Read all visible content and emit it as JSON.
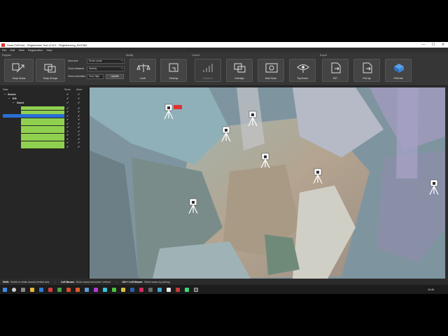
{
  "window": {
    "title": "Scan PinPoint · Registration Tool v2.6.0 · Registrierung_BLK360",
    "minimize": "—",
    "maximize": "☐",
    "close": "✕"
  },
  "menu": [
    "File",
    "Edit",
    "View",
    "Registration",
    "Help"
  ],
  "toolbar": {
    "groups": {
      "register": "Register",
      "modify": "Modify",
      "control": "Control",
      "export": "Export"
    },
    "buttons": {
      "snap_scans": "Snap Scans",
      "snap_groups": "Snap Groups",
      "level": "Level",
      "cleanup": "Cleanup",
      "distance": "Distance",
      "overlaps": "Overlaps",
      "next_scan": "Next Scan",
      "top_down": "Top-Down",
      "e57": "E57",
      "pdf": "PixCap",
      "pinpoint": "PinPoint"
    },
    "fields": {
      "area_size_label": "Area size",
      "area_size_value": "Room-scale",
      "cloud_distance_label": "Cloud distance",
      "cloud_distance_value": "Nearby",
      "cloud_resolution_label": "Cloud resolution",
      "cloud_resolution_value": "Very High",
      "update_button": "Update"
    }
  },
  "panel": {
    "col_data": "Data",
    "col_show": "Show",
    "col_move": "Move",
    "tree": {
      "scene": "Scene",
      "eg": "EG",
      "group": "Sued"
    },
    "scan_rows": 11,
    "checkmark": "✔"
  },
  "statusbar": {
    "shift_key": "Shift:",
    "shift_text": "Switch to rotate around vertical axis",
    "left_key": "Left Mouse:",
    "left_text": "Move scans horizontal / vertical",
    "ctrl_key": "Ctrl + Left Mouse:",
    "ctrl_text": "Select scans by picking"
  },
  "taskbar": {
    "time": "10:49",
    "date": ""
  },
  "colors": {
    "accent_green": "#8fd14f",
    "selected_blue": "#2a6fd6",
    "marker_red": "#e03030"
  }
}
